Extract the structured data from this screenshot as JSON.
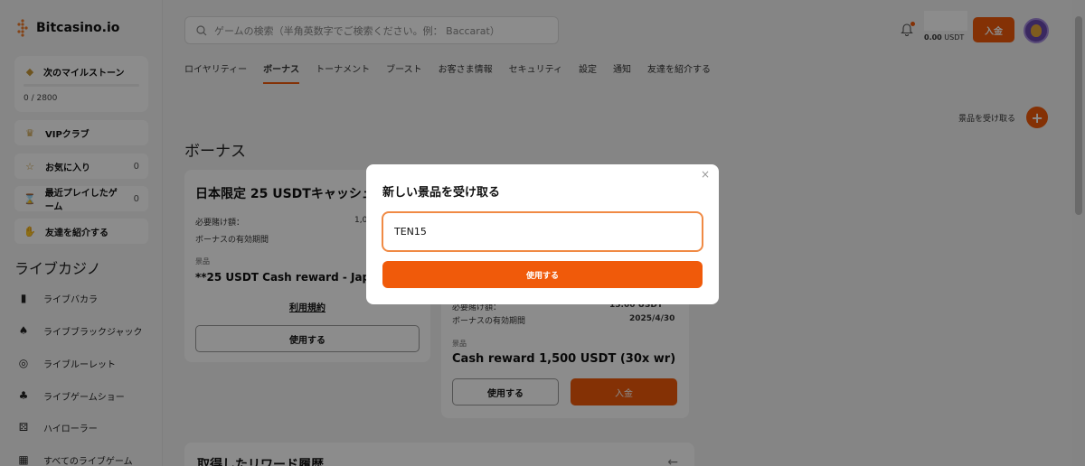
{
  "brand": {
    "name": "Bitcasino.io"
  },
  "sidebar": {
    "milestone": {
      "label": "次のマイルストーン",
      "progress": "0 / 2800",
      "progress_fraction": 0
    },
    "vip": {
      "label": "VIPクラブ"
    },
    "favorites": {
      "label": "お気に入り",
      "count": "0"
    },
    "recent": {
      "label": "最近プレイしたゲーム",
      "count": "0"
    },
    "refer": {
      "label": "友達を紹介する"
    },
    "section_title": "ライブカジノ",
    "live_items": [
      {
        "label": "ライブバカラ",
        "icon": "card-icon"
      },
      {
        "label": "ライブブラックジャック",
        "icon": "spade-icon"
      },
      {
        "label": "ライブルーレット",
        "icon": "roulette-icon"
      },
      {
        "label": "ライブゲームショー",
        "icon": "gameshow-icon"
      },
      {
        "label": "ハイローラー",
        "icon": "dice-icon"
      },
      {
        "label": "すべてのライブゲーム",
        "icon": "grid-icon"
      }
    ]
  },
  "search": {
    "placeholder": "ゲームの検索（半角英数字でご検索ください。例： Baccarat）"
  },
  "tabs": [
    "ロイヤリティー",
    "ボーナス",
    "トーナメント",
    "ブースト",
    "お客さま情報",
    "セキュリティ",
    "設定",
    "通知",
    "友達を紹介する"
  ],
  "active_tab": "ボーナス",
  "header": {
    "balance": "0.00",
    "currency": "USDT",
    "deposit_label": "入金"
  },
  "receive_prize_label": "景品を受け取る",
  "page_title": "ボーナス",
  "bonus_card_1": {
    "title": "日本限定 25 USDTキャッシュ",
    "wager_label": "必要賭け額：",
    "wager_value": "1,0",
    "expiry_label": "ボーナスの有効期間",
    "prize_label": "景品",
    "prize": "**25 USDT Cash reward - Japa",
    "terms": "利用規約",
    "use_label": "使用する"
  },
  "bonus_card_2": {
    "wager_label": "必要賭け額：",
    "wager_value": "15.00 USDT",
    "expiry_label": "ボーナスの有効期間",
    "expiry_value": "2025/4/30",
    "prize_label": "景品",
    "prize": "Cash reward 1,500 USDT (30x wr)",
    "use_label": "使用する",
    "deposit_label": "入金"
  },
  "history": {
    "title": "取得したリワード履歴"
  },
  "modal": {
    "title": "新しい景品を受け取る",
    "input_value": "TEN15",
    "submit_label": "使用する"
  },
  "colors": {
    "accent": "#f05a0a",
    "overlay": "rgba(0,0,0,0.45)"
  }
}
